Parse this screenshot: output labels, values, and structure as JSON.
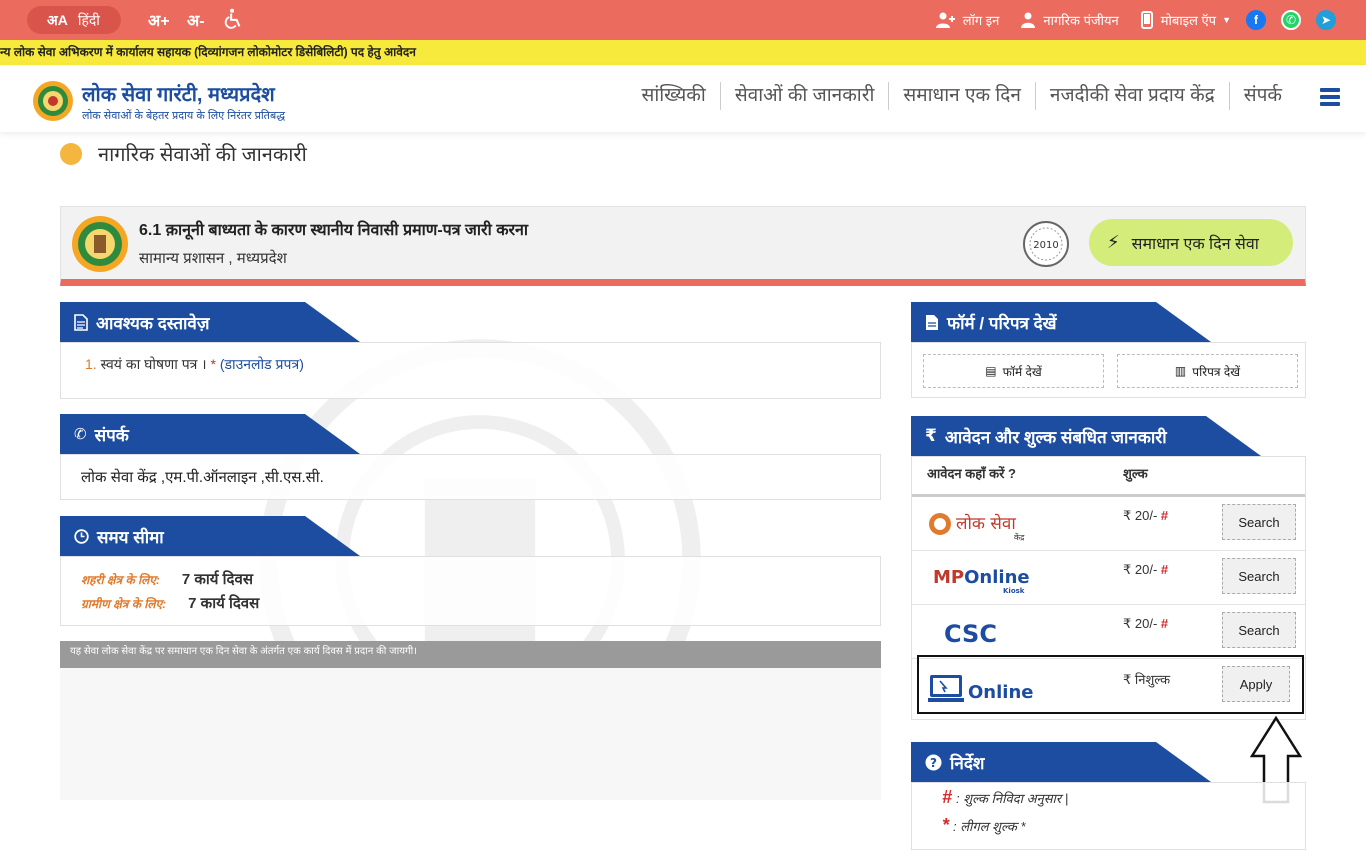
{
  "topbar": {
    "lang_glyph": "अA",
    "lang_label": "हिंदी",
    "font_increase": "अ+",
    "font_decrease": "अ-",
    "login": "लॉग इन",
    "register": "नागरिक पंजीयन",
    "mobile_app": "मोबाइल ऍप",
    "colors": {
      "bar": "#ec6b5f",
      "facebook": "#1877f2",
      "whatsapp": "#25d366",
      "telegram": "#229ed9"
    }
  },
  "marquee": "न्य लोक सेवा अभिकरण में कार्यालय सहायक (दिव्यांगजन लोकोमोटर डिसेबिलिटी) पद हेतु आवेदन",
  "header": {
    "title": "लोक सेवा गारंटी, मध्यप्रदेश",
    "subtitle": "लोक सेवाओं के बेहतर प्रदाय के लिए निरंतर प्रतिबद्ध",
    "nav": [
      "सांख्यिकी",
      "सेवाओं की जानकारी",
      "समाधान एक दिन",
      "नजदीकी सेवा प्रदाय केंद्र",
      "संपर्क"
    ]
  },
  "page_heading": "नागरिक सेवाओं की जानकारी",
  "service": {
    "title": "6.1 क़ानूनी बाध्यता के कारण स्थानीय निवासी प्रमाण-पत्र जारी करना",
    "department": "सामान्य प्रशासन , मध्यप्रदेश",
    "badge_year": "2010",
    "samadhan_label": "समाधान एक दिन सेवा"
  },
  "documents": {
    "heading": "आवश्यक दस्तावेज़",
    "item_num": "1.",
    "item_text": "स्वयं का घोषणा पत्र ।",
    "item_star": "*",
    "item_link": "(डाउनलोड प्रपत्र)"
  },
  "contact": {
    "heading": "संपर्क",
    "text": "लोक सेवा केंद्र ,एम.पी.ऑनलाइन ,सी.एस.सी."
  },
  "time_limit": {
    "heading": "समय सीमा",
    "urban_label": "शहरी क्षेत्र के लिए:",
    "urban_value": "7 कार्य दिवस",
    "rural_label": "ग्रामीण क्षेत्र के लिए:",
    "rural_value": "7 कार्य दिवस"
  },
  "note": "यह सेवा लोक सेवा केंद्र पर समाधान एक दिन सेवा के अंतर्गत एक कार्य दिवस में प्रदान की जायगी।",
  "forms": {
    "heading": "फॉर्म / परिपत्र देखें",
    "form_btn": "फॉर्म देखें",
    "circular_btn": "परिपत्र देखें"
  },
  "fees": {
    "heading": "आवेदन और शुल्क संबधित जानकारी",
    "col_where": "आवेदन कहाँ करें ?",
    "col_fee": "शुल्क",
    "rows": [
      {
        "provider": "लोक सेवा",
        "provider_sub": "केंद्र",
        "amount": "₹ 20/-",
        "mark": "#",
        "action": "Search"
      },
      {
        "provider": "MPOnline",
        "provider_sub": "Kiosk",
        "amount": "₹ 20/-",
        "mark": "#",
        "action": "Search"
      },
      {
        "provider": "CSC",
        "provider_sub": "",
        "amount": "₹ 20/-",
        "mark": "#",
        "action": "Search"
      },
      {
        "provider": "Online",
        "provider_sub": "",
        "amount": "₹ निशुल्क",
        "mark": "",
        "action": "Apply"
      }
    ]
  },
  "instructions": {
    "heading": "निर्देश",
    "hash_sym": "#",
    "hash_text": ": शुल्क निविदा अनुसार |",
    "star_sym": "*",
    "star_text": ": लीगल शुल्क *"
  },
  "accent_colors": {
    "primary": "#1c4da1",
    "samadhan": "#d4ed7a",
    "marquee": "#f8ea3c",
    "orange": "#e07b2e"
  }
}
